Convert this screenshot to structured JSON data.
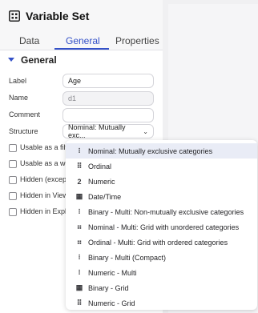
{
  "header": {
    "title": "Variable Set",
    "icon": "variable-set-icon"
  },
  "tabs": [
    {
      "label": "Data",
      "active": false
    },
    {
      "label": "General",
      "active": true
    },
    {
      "label": "Properties",
      "active": false
    }
  ],
  "section": {
    "title": "General"
  },
  "fields": {
    "label": {
      "label": "Label",
      "value": "Age"
    },
    "name": {
      "label": "Name",
      "value": "d1"
    },
    "comment": {
      "label": "Comment",
      "value": ""
    },
    "structure": {
      "label": "Structure",
      "value": "Nominal: Mutually exc..."
    }
  },
  "checkboxes": [
    {
      "label": "Usable as a filte"
    },
    {
      "label": "Usable as a wei"
    },
    {
      "label": "Hidden (except"
    },
    {
      "label": "Hidden in View"
    },
    {
      "label": "Hidden in Explo"
    }
  ],
  "dropdown": {
    "options": [
      {
        "label": "Nominal: Mutually exclusive categories",
        "icon": "⁝",
        "selected": true
      },
      {
        "label": "Ordinal",
        "icon": "⠿",
        "selected": false
      },
      {
        "label": "Numeric",
        "icon": "2",
        "selected": false
      },
      {
        "label": "Date/Time",
        "icon": "▦",
        "selected": false
      },
      {
        "label": "Binary - Multi: Non-mutually exclusive categories",
        "icon": "⁝",
        "selected": false
      },
      {
        "label": "Nominal - Multi: Grid with unordered categories",
        "icon": "⠶",
        "selected": false
      },
      {
        "label": "Ordinal - Multi: Grid with ordered categories",
        "icon": "⠶",
        "selected": false
      },
      {
        "label": "Binary - Multi (Compact)",
        "icon": "⁝",
        "selected": false
      },
      {
        "label": "Numeric - Multi",
        "icon": "⁝",
        "selected": false
      },
      {
        "label": "Binary - Grid",
        "icon": "▦",
        "selected": false
      },
      {
        "label": "Numeric - Grid",
        "icon": "⠿",
        "selected": false
      }
    ]
  },
  "colors": {
    "accent": "#3451c8",
    "selected_bg": "#e9ecf6"
  }
}
